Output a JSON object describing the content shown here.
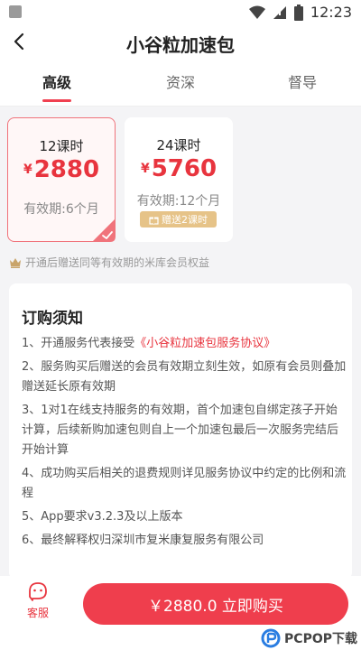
{
  "status_bar": {
    "time": "12:23"
  },
  "header": {
    "title": "小谷粒加速包"
  },
  "tabs": [
    {
      "label": "高级",
      "active": true
    },
    {
      "label": "资深",
      "active": false
    },
    {
      "label": "督导",
      "active": false
    }
  ],
  "packages": [
    {
      "hours": "12课时",
      "currency": "¥",
      "price": "2880",
      "validity": "有效期:6个月",
      "selected": true
    },
    {
      "hours": "24课时",
      "currency": "¥",
      "price": "5760",
      "validity": "有效期:12个月",
      "gift": "赠送2课时",
      "selected": false
    }
  ],
  "member_note": "开通后赠送同等有效期的米库会员权益",
  "notice": {
    "title": "订购须知",
    "items": [
      {
        "prefix": "1、开通服务代表接受",
        "link": "《小谷粒加速包服务协议》"
      },
      {
        "text": "2、服务购买后赠送的会员有效期立刻生效，如原有会员则叠加赠送延长原有效期"
      },
      {
        "text": "3、1对1在线支持服务的有效期，首个加速包自绑定孩子开始计算，后续新购加速包则自上一个加速包最后一次服务完结后开始计算"
      },
      {
        "text": "4、成功购买后相关的退费规则详见服务协议中约定的比例和流程"
      },
      {
        "text": "5、App要求v3.2.3及以上版本"
      },
      {
        "text": "6、最终解释权归深圳市复米康复服务有限公司"
      }
    ]
  },
  "bottom": {
    "service_label": "客服",
    "buy_label": "￥2880.0  立即购买"
  },
  "watermark": {
    "text": "PCPOP下载"
  },
  "colors": {
    "accent": "#ef3e4d",
    "gift": "#e6c388",
    "crown": "#c9a46a"
  },
  "icons": [
    "back-icon",
    "wifi-icon",
    "signal-icon",
    "battery-icon",
    "crown-icon",
    "gift-icon",
    "check-icon",
    "service-icon"
  ]
}
